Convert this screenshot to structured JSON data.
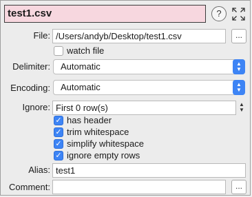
{
  "title": "test1.csv",
  "help_symbol": "?",
  "file": {
    "label": "File:",
    "value": "/Users/andyb/Desktop/test1.csv",
    "browse": "..."
  },
  "watch_file": {
    "label": "watch file",
    "checked": false
  },
  "delimiter": {
    "label": "Delimiter:",
    "value": "Automatic"
  },
  "encoding": {
    "label": "Encoding:",
    "value": "Automatic"
  },
  "ignore": {
    "label": "Ignore:",
    "value": "First 0 row(s)"
  },
  "options": [
    {
      "label": "has header",
      "checked": true
    },
    {
      "label": "trim whitespace",
      "checked": true
    },
    {
      "label": "simplify whitespace",
      "checked": true
    },
    {
      "label": "ignore empty rows",
      "checked": true
    }
  ],
  "alias": {
    "label": "Alias:",
    "value": "test1"
  },
  "comment": {
    "label": "Comment:",
    "value": "",
    "browse": "..."
  },
  "colors": {
    "accent": "#3d84f5",
    "title_bg": "#f7d7df"
  }
}
